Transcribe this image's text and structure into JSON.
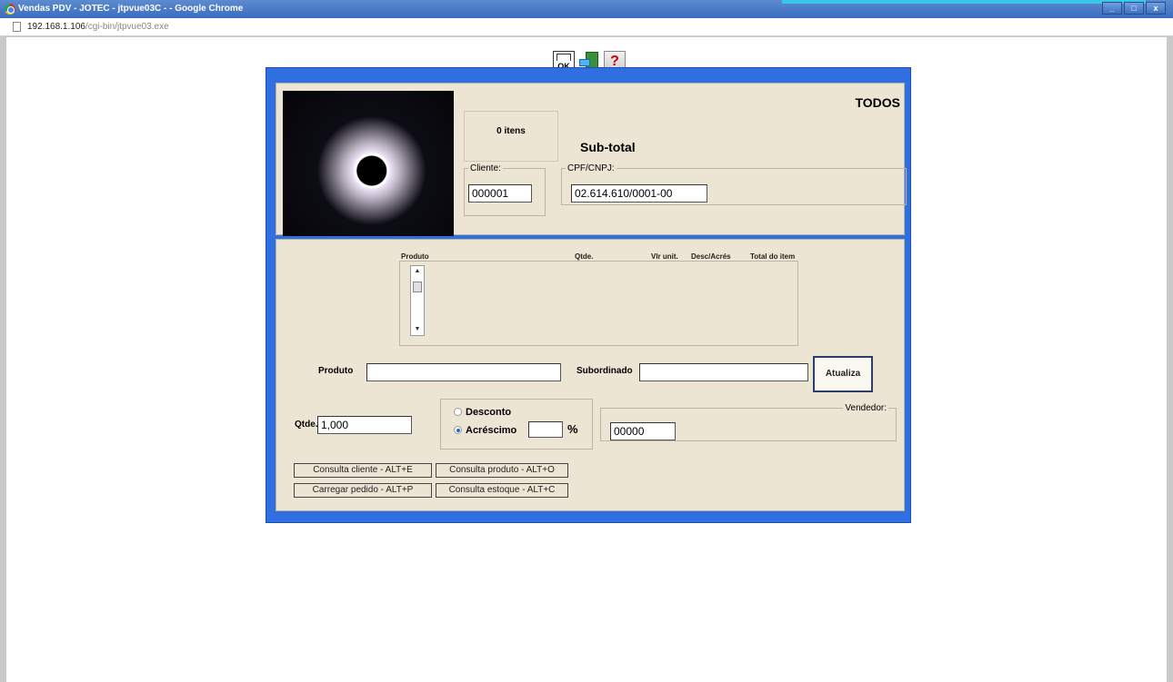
{
  "window": {
    "title": "Vendas PDV - JOTEC - jtpvue03C - - Google Chrome",
    "controls": {
      "minimize": "_",
      "maximize": "□",
      "close": "x"
    }
  },
  "address": {
    "host": "192.168.1.106",
    "path": "/cgi-bin/jtpvue03.exe"
  },
  "toolbar": {
    "ok_label": "OK",
    "help_label": "?"
  },
  "header": {
    "items_count": "0 itens",
    "subtotal_label": "Sub-total",
    "filter": "TODOS"
  },
  "cliente": {
    "legend": "Cliente:",
    "value": "000001"
  },
  "cpf": {
    "legend": "CPF/CNPJ:",
    "value": "02.614.610/0001-00"
  },
  "grid": {
    "columns": [
      "Produto",
      "Qtde.",
      "Vlr unit.",
      "Desc/Acrés",
      "Total do item"
    ],
    "rows": []
  },
  "produto": {
    "label": "Produto",
    "value": ""
  },
  "subordinado": {
    "label": "Subordinado",
    "value": ""
  },
  "atualiza_label": "Atualiza",
  "qtde": {
    "label": "Qtde.",
    "value": "1,000"
  },
  "ajuste": {
    "desconto_label": "Desconto",
    "acrescimo_label": "Acréscimo",
    "selected": "Acréscimo",
    "percent_value": "",
    "percent_symbol": "%"
  },
  "vendedor": {
    "legend": "Vendedor:",
    "value": "00000"
  },
  "actions": {
    "consulta_cliente": "Consulta cliente - ALT+E",
    "consulta_produto": "Consulta produto - ALT+O",
    "carregar_pedido": "Carregar pedido - ALT+P",
    "consulta_estoque": "Consulta estoque  - ALT+C"
  }
}
